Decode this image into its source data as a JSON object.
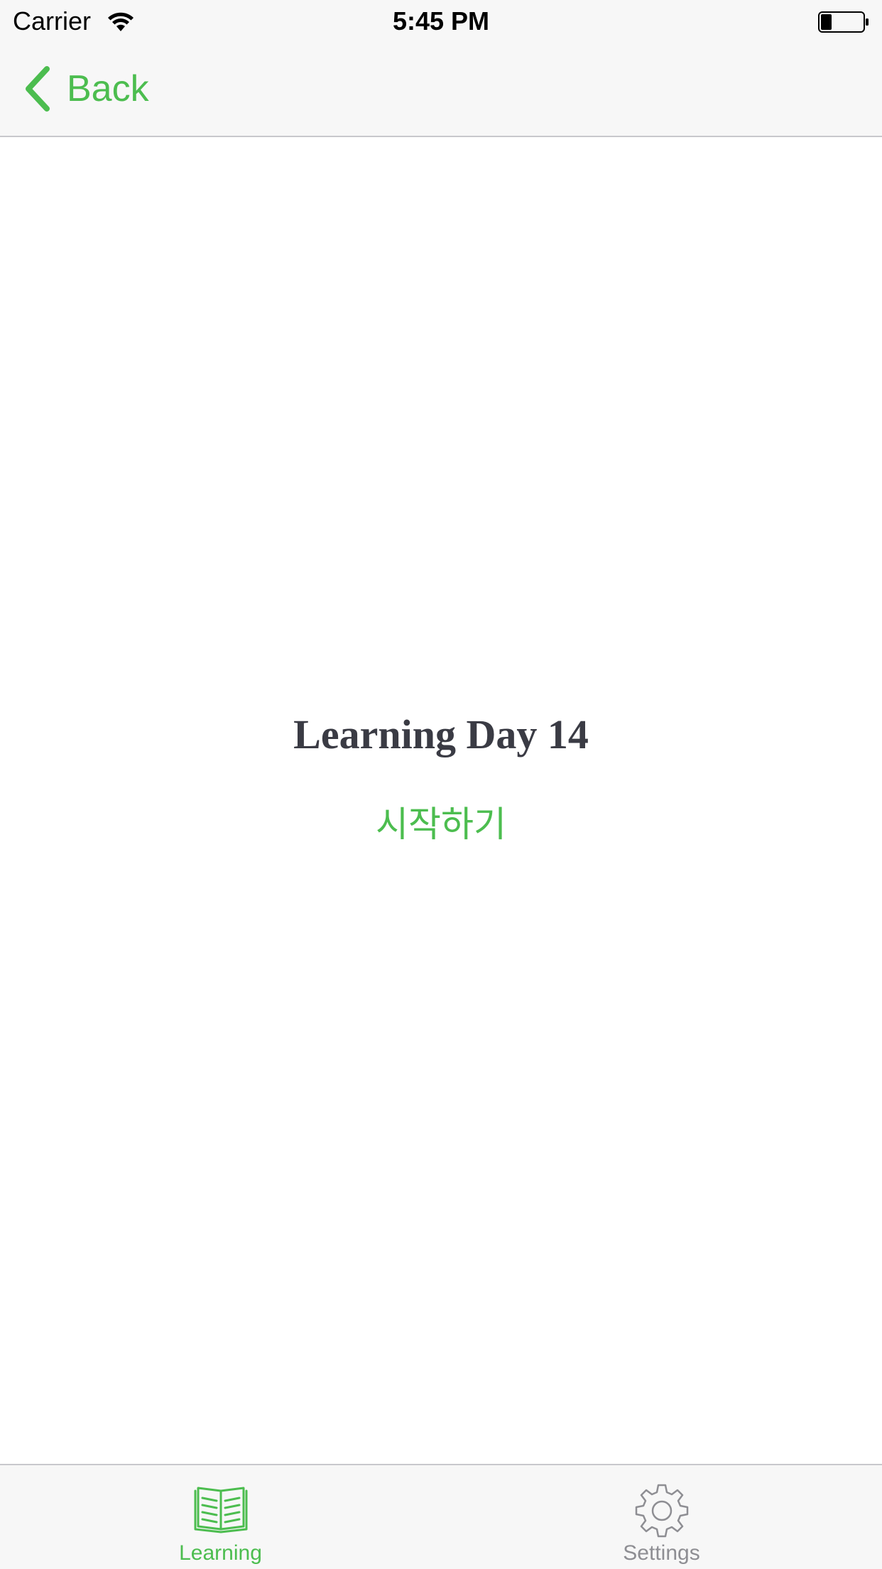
{
  "status_bar": {
    "carrier": "Carrier",
    "time": "5:45 PM",
    "wifi_icon": "wifi-icon",
    "battery_icon": "battery-low-icon"
  },
  "nav_bar": {
    "back_label": "Back",
    "back_icon": "chevron-left-icon"
  },
  "main": {
    "title": "Learning Day 14",
    "start_label": "시작하기"
  },
  "tab_bar": {
    "tabs": [
      {
        "label": "Learning",
        "icon": "book-icon",
        "selected": true
      },
      {
        "label": "Settings",
        "icon": "gear-icon",
        "selected": false
      }
    ]
  },
  "colors": {
    "accent": "#4cbd4f",
    "title_text": "#3a3b44",
    "inactive_tab": "#8e8e93",
    "bar_background": "#f7f7f7",
    "separator": "#c8c8cc"
  }
}
